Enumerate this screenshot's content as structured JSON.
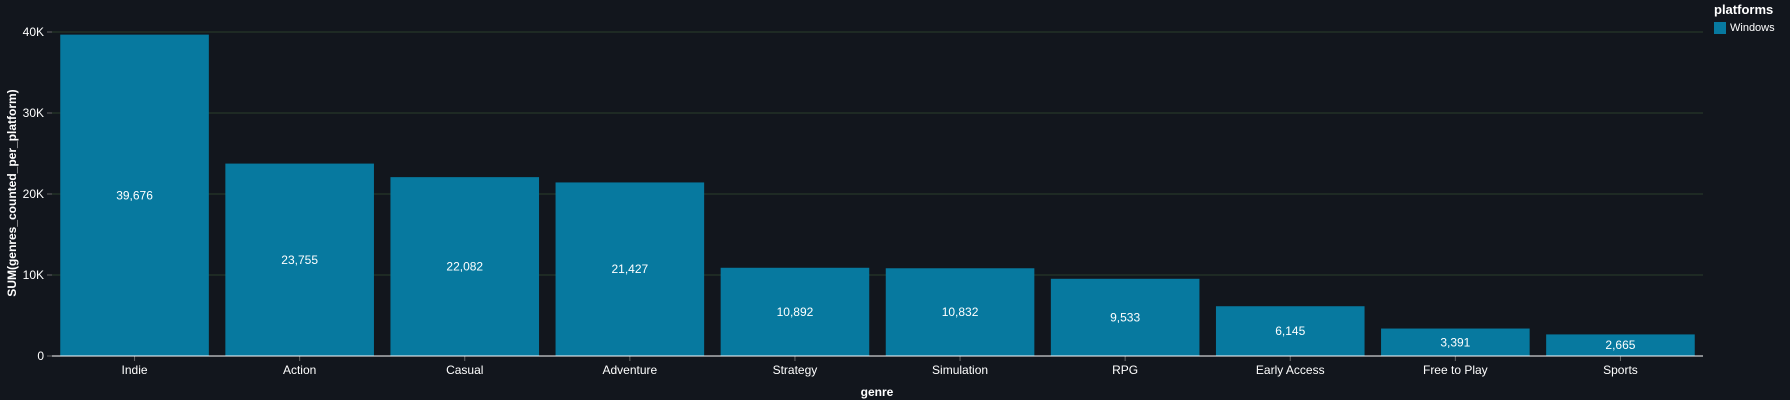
{
  "chart_data": {
    "type": "bar",
    "categories": [
      "Indie",
      "Action",
      "Casual",
      "Adventure",
      "Strategy",
      "Simulation",
      "RPG",
      "Early Access",
      "Free to Play",
      "Sports"
    ],
    "series": [
      {
        "name": "Windows",
        "values": [
          39676,
          23755,
          22082,
          21427,
          10892,
          10832,
          9533,
          6145,
          3391,
          2665
        ],
        "labels": [
          "39,676",
          "23,755",
          "22,082",
          "21,427",
          "10,892",
          "10,832",
          "9,533",
          "6,145",
          "3,391",
          "2,665"
        ]
      }
    ],
    "xlabel": "genre",
    "ylabel": "SUM(genres_counted_per_platform)",
    "ylim": [
      0,
      40000
    ],
    "yticks": [
      0,
      10000,
      20000,
      30000,
      40000
    ],
    "ytick_labels": [
      "0",
      "10K",
      "20K",
      "30K",
      "40K"
    ],
    "grid": true,
    "legend": {
      "title": "platforms",
      "placement": "top-right"
    },
    "colors": {
      "bar": "#07799f",
      "background": "#12161d",
      "grid": "#2b3e2b",
      "text": "#ffffff",
      "axis": "#ffffff"
    }
  }
}
